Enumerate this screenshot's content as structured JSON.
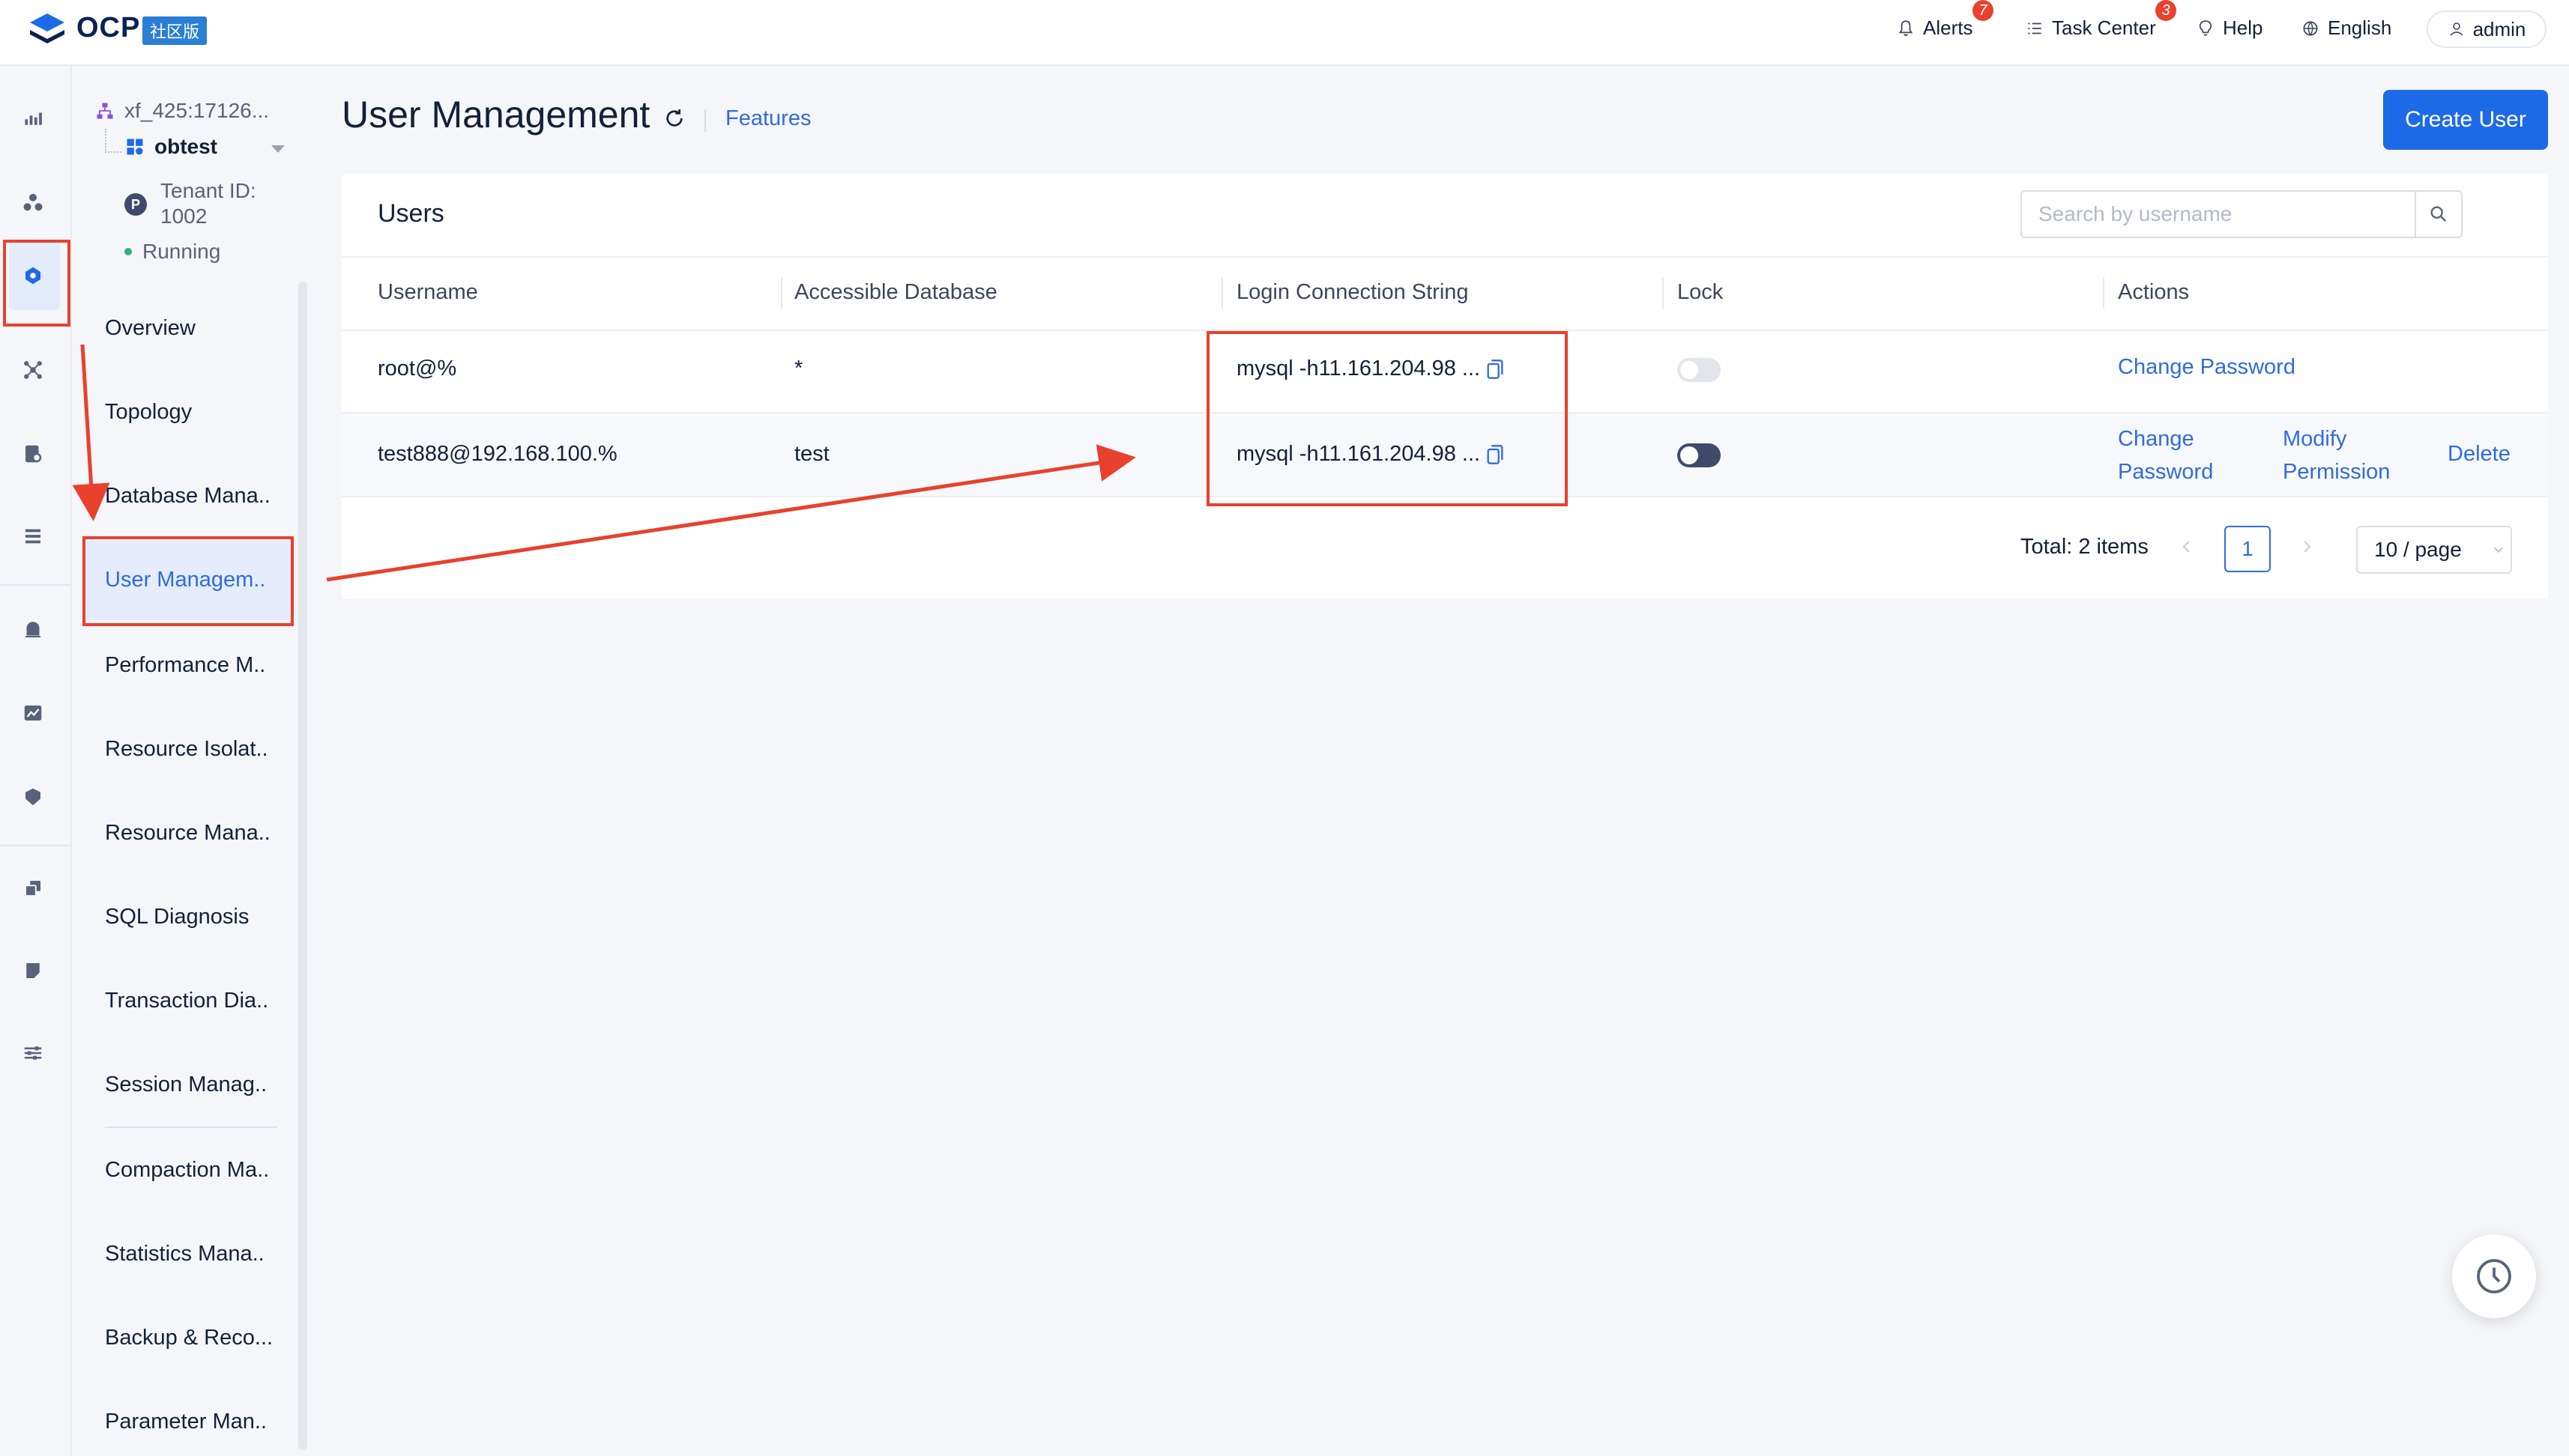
{
  "brand": {
    "logo_text": "OCP",
    "edition": "社区版"
  },
  "topnav": {
    "alerts_label": "Alerts",
    "alerts_count": "7",
    "task_center_label": "Task Center",
    "task_center_count": "3",
    "help_label": "Help",
    "language_label": "English",
    "user_label": "admin"
  },
  "iconbar": {
    "items": [
      "chart-icon",
      "cluster-icon",
      "tenant-icon",
      "topology-icon",
      "sql-icon",
      "list-icon",
      "alarm-icon",
      "monitor-icon",
      "shield-icon",
      "backup-icon",
      "note-icon",
      "settings-icon"
    ],
    "active": "tenant-icon"
  },
  "sidebar": {
    "cluster_name": "xf_425:17126...",
    "tenant_name": "obtest",
    "tenant_id_label": "Tenant ID: 1002",
    "status": "Running",
    "menu": [
      "Overview",
      "Topology",
      "Database Mana..",
      "User Managem..",
      "Performance M..",
      "Resource Isolat..",
      "Resource Mana..",
      "SQL Diagnosis",
      "Transaction Dia..",
      "Session Manag..",
      "Compaction Ma..",
      "Statistics Mana..",
      "Backup & Reco...",
      "Parameter Man.."
    ],
    "active_index": 3
  },
  "page": {
    "title": "User Management",
    "features_link": "Features",
    "create_button": "Create User"
  },
  "users_card": {
    "title": "Users",
    "search_placeholder": "Search by username",
    "columns": [
      "Username",
      "Accessible Database",
      "Login Connection String",
      "Lock",
      "Actions"
    ],
    "rows": [
      {
        "username": "root@%",
        "database": "*",
        "connection": "mysql -h11.161.204.98 ...",
        "locked": false,
        "actions": [
          "Change Password"
        ]
      },
      {
        "username": "test888@192.168.100.%",
        "database": "test",
        "connection": "mysql -h11.161.204.98 ...",
        "locked": true,
        "actions": [
          "Change Password",
          "Modify Permission",
          "Delete"
        ]
      }
    ],
    "pagination": {
      "total": "Total: 2 items",
      "current_page": "1",
      "page_size": "10 / page"
    }
  },
  "colors": {
    "primary": "#1d6ae6",
    "link": "#2f6be0",
    "annotation": "#e8412e",
    "switch_on": "#3f4a6b",
    "switch_off": "#e2e5ec"
  }
}
